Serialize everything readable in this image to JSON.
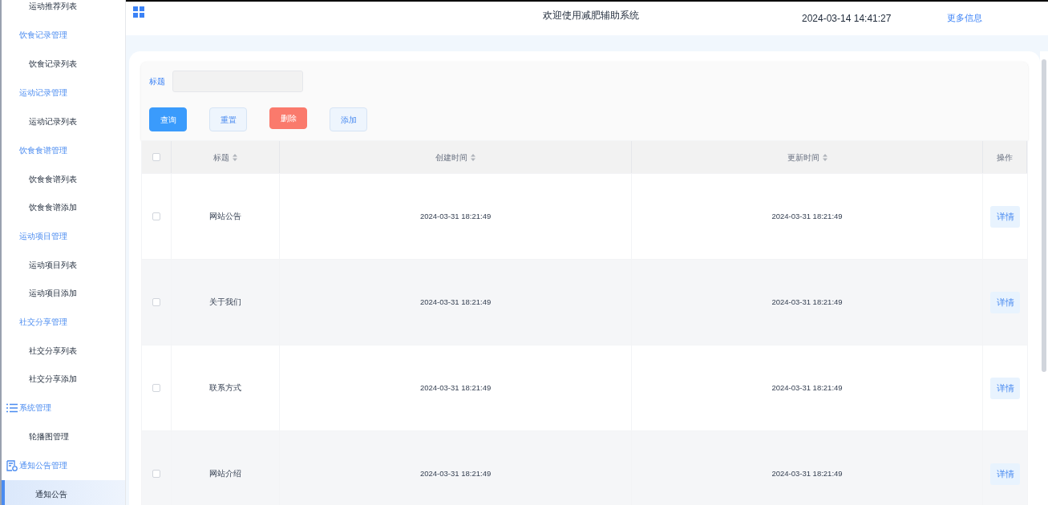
{
  "sidebar": {
    "items": [
      {
        "kind": "item",
        "label": "运动推荐列表",
        "selected": false
      },
      {
        "kind": "group",
        "label": "饮食记录管理"
      },
      {
        "kind": "item",
        "label": "饮食记录列表",
        "selected": false
      },
      {
        "kind": "group",
        "label": "运动记录管理"
      },
      {
        "kind": "item",
        "label": "运动记录列表",
        "selected": false
      },
      {
        "kind": "group",
        "label": "饮食食谱管理"
      },
      {
        "kind": "item",
        "label": "饮食食谱列表",
        "selected": false
      },
      {
        "kind": "item",
        "label": "饮食食谱添加",
        "selected": false
      },
      {
        "kind": "group",
        "label": "运动项目管理"
      },
      {
        "kind": "item",
        "label": "运动项目列表",
        "selected": false
      },
      {
        "kind": "item",
        "label": "运动项目添加",
        "selected": false
      },
      {
        "kind": "group",
        "label": "社交分享管理"
      },
      {
        "kind": "item",
        "label": "社交分享列表",
        "selected": false
      },
      {
        "kind": "item",
        "label": "社交分享添加",
        "selected": false
      },
      {
        "kind": "list-group",
        "label": "系统管理"
      },
      {
        "kind": "item",
        "label": "轮播图管理",
        "selected": false
      },
      {
        "kind": "notice-group",
        "label": "通知公告管理"
      },
      {
        "kind": "item",
        "label": "通知公告",
        "selected": true
      }
    ]
  },
  "header": {
    "title": "欢迎使用减肥辅助系统",
    "datetime": "2024-03-14 14:41:27",
    "more_link": "更多信息"
  },
  "search": {
    "label": "标题",
    "buttons": [
      {
        "kind": "primary",
        "label": "查询"
      },
      {
        "kind": "plain",
        "label": "重置"
      },
      {
        "kind": "danger",
        "label": "删除"
      },
      {
        "kind": "plain",
        "label": "添加"
      }
    ]
  },
  "table": {
    "all_checked": false,
    "columns": [
      {
        "label": "标题",
        "sortable": true
      },
      {
        "label": "创建时间",
        "sortable": true
      },
      {
        "label": "更新时间",
        "sortable": true
      },
      {
        "label": "操作",
        "sortable": false
      }
    ],
    "rows": [
      {
        "checked": false,
        "title": "网站公告",
        "created": "2024-03-31 18:21:49",
        "updated": "2024-03-31 18:21:49",
        "action": "详情"
      },
      {
        "checked": false,
        "title": "关于我们",
        "created": "2024-03-31 18:21:49",
        "updated": "2024-03-31 18:21:49",
        "action": "详情"
      },
      {
        "checked": false,
        "title": "联系方式",
        "created": "2024-03-31 18:21:49",
        "updated": "2024-03-31 18:21:49",
        "action": "详情"
      },
      {
        "checked": false,
        "title": "网站介绍",
        "created": "2024-03-31 18:21:49",
        "updated": "2024-03-31 18:21:49",
        "action": "详情"
      }
    ]
  }
}
